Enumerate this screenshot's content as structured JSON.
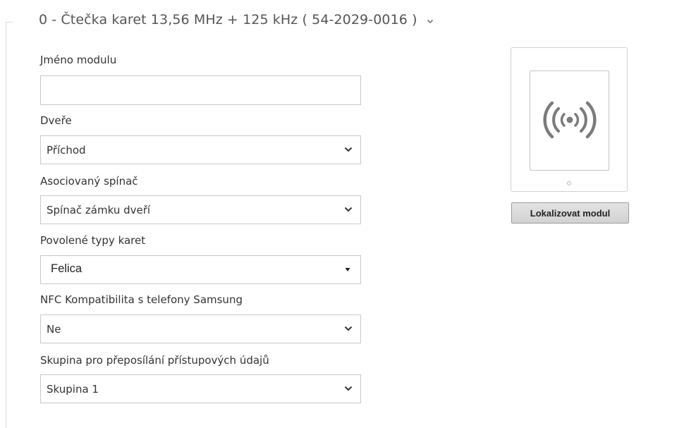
{
  "module": {
    "title": "0 - Čtečka karet 13,56 MHz + 125 kHz ( 54-2029-0016 )"
  },
  "fields": {
    "name": {
      "label": "Jméno modulu",
      "value": "",
      "placeholder": ""
    },
    "door": {
      "label": "Dveře",
      "value": "Příchod"
    },
    "switch": {
      "label": "Asociovaný spínač",
      "value": "Spínač zámku dveří"
    },
    "card_types": {
      "label": "Povolené typy karet",
      "value": "Felica"
    },
    "nfc": {
      "label": "NFC Kompatibilita s telefony Samsung",
      "value": "Ne"
    },
    "forward_group": {
      "label": "Skupina pro přeposílání přístupových údajů",
      "value": "Skupina 1"
    }
  },
  "locate_button": {
    "label": "Lokalizovat modul"
  },
  "icons": {
    "chevron": "chevron-down-icon",
    "nfc": "nfc-waves-icon",
    "dropdown_triangle": "triangle-down-icon"
  },
  "colors": {
    "text": "#333333",
    "header_text": "#555555",
    "border": "#c8c8c8",
    "button_bg": "#d9d9d9"
  }
}
